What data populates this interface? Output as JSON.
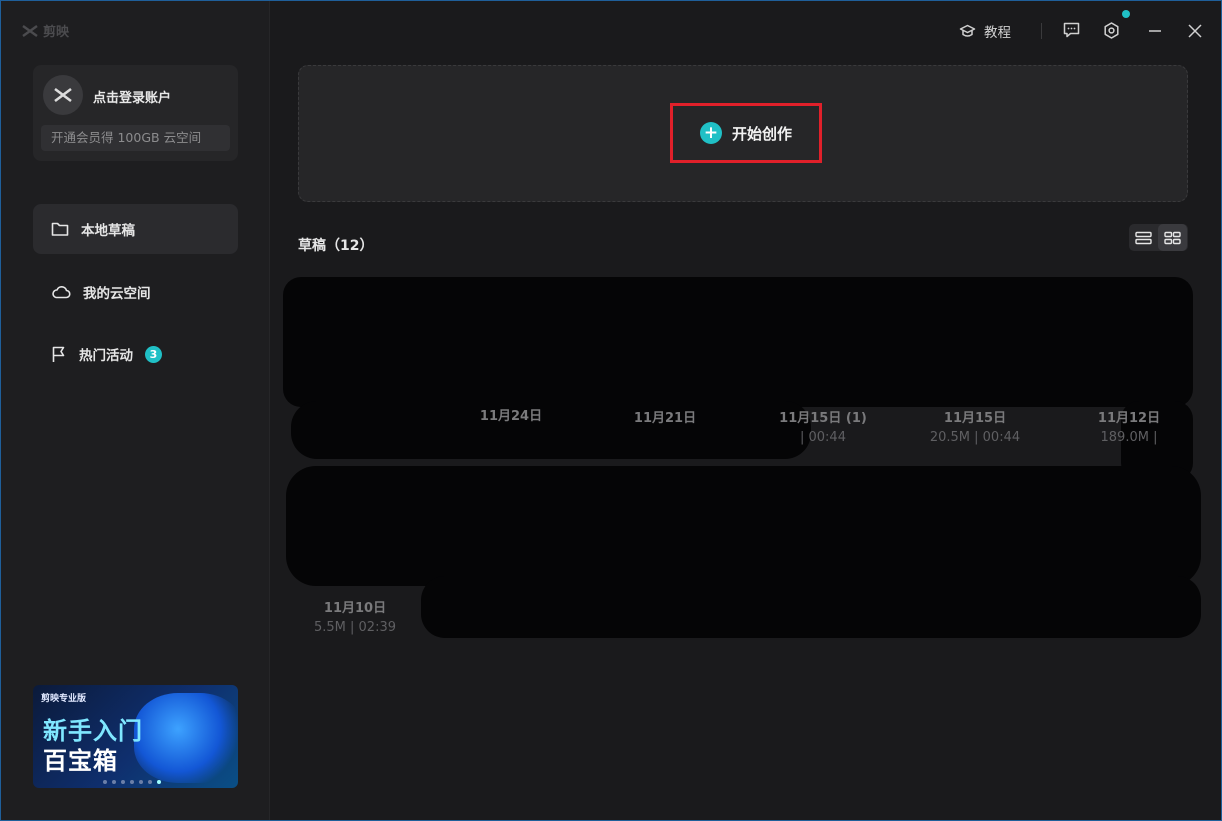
{
  "app": {
    "logo_text": "剪映"
  },
  "sidebar": {
    "account": {
      "login": "点击登录账户",
      "vip_promo": "开通会员得 100GB 云空间"
    },
    "items": [
      {
        "label": "本地草稿",
        "icon": "folder-icon",
        "active": true
      },
      {
        "label": "我的云空间",
        "icon": "cloud-icon",
        "active": false
      },
      {
        "label": "热门活动",
        "icon": "flag-icon",
        "active": false,
        "badge": "3"
      }
    ],
    "promo": {
      "brand": "剪映专业版",
      "line1": "新手入门",
      "line2": "百宝箱"
    }
  },
  "topbar": {
    "tutorial": "教程"
  },
  "main": {
    "create_label": "开始创作",
    "drafts_title": "草稿（12）",
    "drafts": [
      {
        "date": "11月24日",
        "info": ""
      },
      {
        "date": "11月21日",
        "info": ""
      },
      {
        "date": "11月15日 (1)",
        "info": "| 00:44"
      },
      {
        "date": "11月15日",
        "info": "20.5M | 00:44"
      },
      {
        "date": "11月12日",
        "info": "189.0M |"
      },
      {
        "date": "11月10日",
        "info": "5.5M | 02:39"
      }
    ]
  },
  "colors": {
    "accent": "#20c0c6",
    "highlight": "#e0202a",
    "background": "#1a1a1c"
  }
}
